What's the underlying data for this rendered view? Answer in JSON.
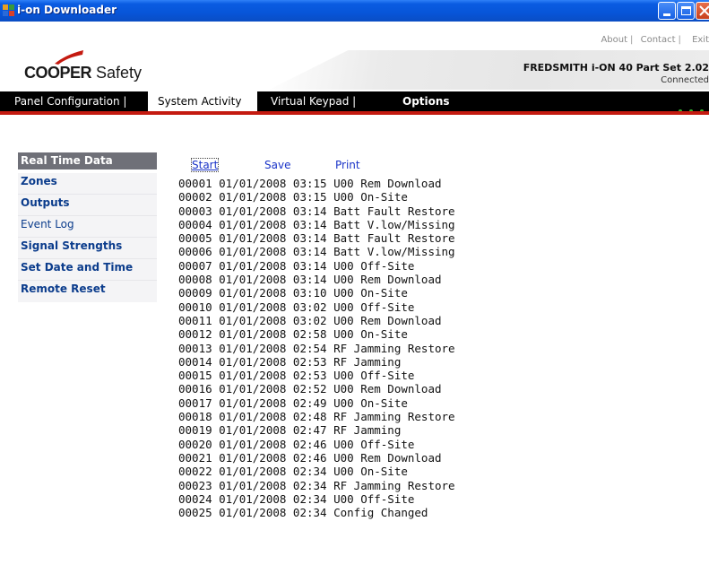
{
  "window": {
    "title": "i-on Downloader"
  },
  "header": {
    "links": [
      "About",
      "Contact",
      "Exit"
    ],
    "link_separator": "|",
    "brand_bold": "COOPER",
    "brand_rest": " Safety",
    "panel_title": "FREDSMITH i-ON 40 Part Set 2.02",
    "panel_status": "Connected"
  },
  "nav": {
    "tabs": [
      {
        "label": "Panel Configuration |"
      },
      {
        "label": "System Activity"
      },
      {
        "label": "Virtual Keypad |"
      },
      {
        "label": "Options"
      }
    ],
    "active_tab": "System Activity"
  },
  "sidebar": {
    "items": [
      {
        "label": "Real Time Data"
      },
      {
        "label": "Zones"
      },
      {
        "label": "Outputs"
      },
      {
        "label": "Event Log"
      },
      {
        "label": "Signal Strengths"
      },
      {
        "label": "Set Date and Time"
      },
      {
        "label": "Remote Reset"
      }
    ]
  },
  "actions": {
    "start": "Start",
    "save": "Save",
    "print": "Print"
  },
  "log": {
    "entries": [
      "00001 01/01/2008 03:15 U00 Rem Download",
      "00002 01/01/2008 03:15 U00 On-Site",
      "00003 01/01/2008 03:14 Batt Fault Restore",
      "00004 01/01/2008 03:14 Batt V.low/Missing",
      "00005 01/01/2008 03:14 Batt Fault Restore",
      "00006 01/01/2008 03:14 Batt V.low/Missing",
      "00007 01/01/2008 03:14 U00 Off-Site",
      "00008 01/01/2008 03:14 U00 Rem Download",
      "00009 01/01/2008 03:10 U00 On-Site",
      "00010 01/01/2008 03:02 U00 Off-Site",
      "00011 01/01/2008 03:02 U00 Rem Download",
      "00012 01/01/2008 02:58 U00 On-Site",
      "00013 01/01/2008 02:54 RF Jamming Restore",
      "00014 01/01/2008 02:53 RF Jamming",
      "00015 01/01/2008 02:53 U00 Off-Site",
      "00016 01/01/2008 02:52 U00 Rem Download",
      "00017 01/01/2008 02:49 U00 On-Site",
      "00018 01/01/2008 02:48 RF Jamming Restore",
      "00019 01/01/2008 02:47 RF Jamming",
      "00020 01/01/2008 02:46 U00 Off-Site",
      "00021 01/01/2008 02:46 U00 Rem Download",
      "00022 01/01/2008 02:34 U00 On-Site",
      "00023 01/01/2008 02:34 RF Jamming Restore",
      "00024 01/01/2008 02:34 U00 Off-Site",
      "00025 01/01/2008 02:34 Config Changed"
    ]
  },
  "colors": {
    "titlebar": "#0755d8",
    "nav_background": "#000000",
    "nav_accent": "#c41a10",
    "sidebar_header": "#6f7078",
    "link": "#1a34c8",
    "status_led": "#2fb82f"
  },
  "icons": {
    "app": "app-icon",
    "minimize": "minimize-icon",
    "maximize": "maximize-icon",
    "close": "close-icon"
  }
}
